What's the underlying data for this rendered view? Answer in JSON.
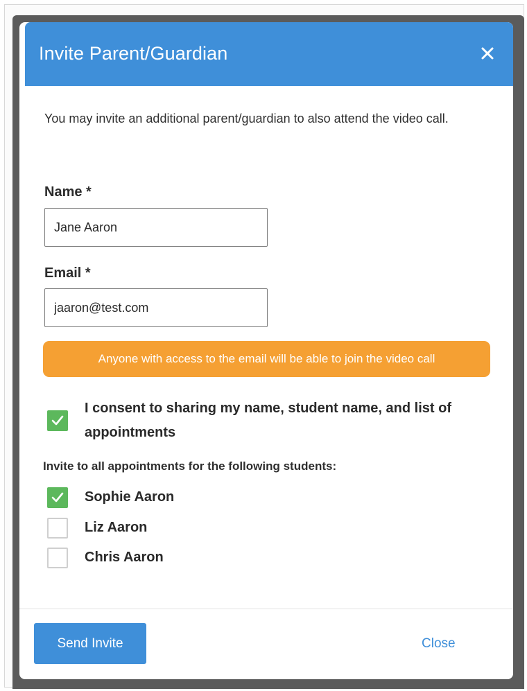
{
  "modal": {
    "title": "Invite Parent/Guardian",
    "close_icon": "close-icon"
  },
  "intro_text": "You may invite an additional parent/guardian to also attend the video call.",
  "form": {
    "name_label": "Name *",
    "name_value": "Jane Aaron",
    "email_label": "Email *",
    "email_value": "jaaron@test.com"
  },
  "warning": {
    "text": "Anyone with access to the email will be able to join the video call"
  },
  "consent": {
    "checked": true,
    "text": "I consent to sharing my name, student name, and list of appointments"
  },
  "students": {
    "heading": "Invite to all appointments for the following students:",
    "items": [
      {
        "name": "Sophie Aaron",
        "checked": true
      },
      {
        "name": "Liz Aaron",
        "checked": false
      },
      {
        "name": "Chris Aaron",
        "checked": false
      }
    ]
  },
  "footer": {
    "send_label": "Send Invite",
    "close_label": "Close"
  },
  "colors": {
    "header": "#3f8fd9",
    "warning": "#f5a033",
    "checked": "#5cb85c",
    "link": "#3f8fd9"
  }
}
